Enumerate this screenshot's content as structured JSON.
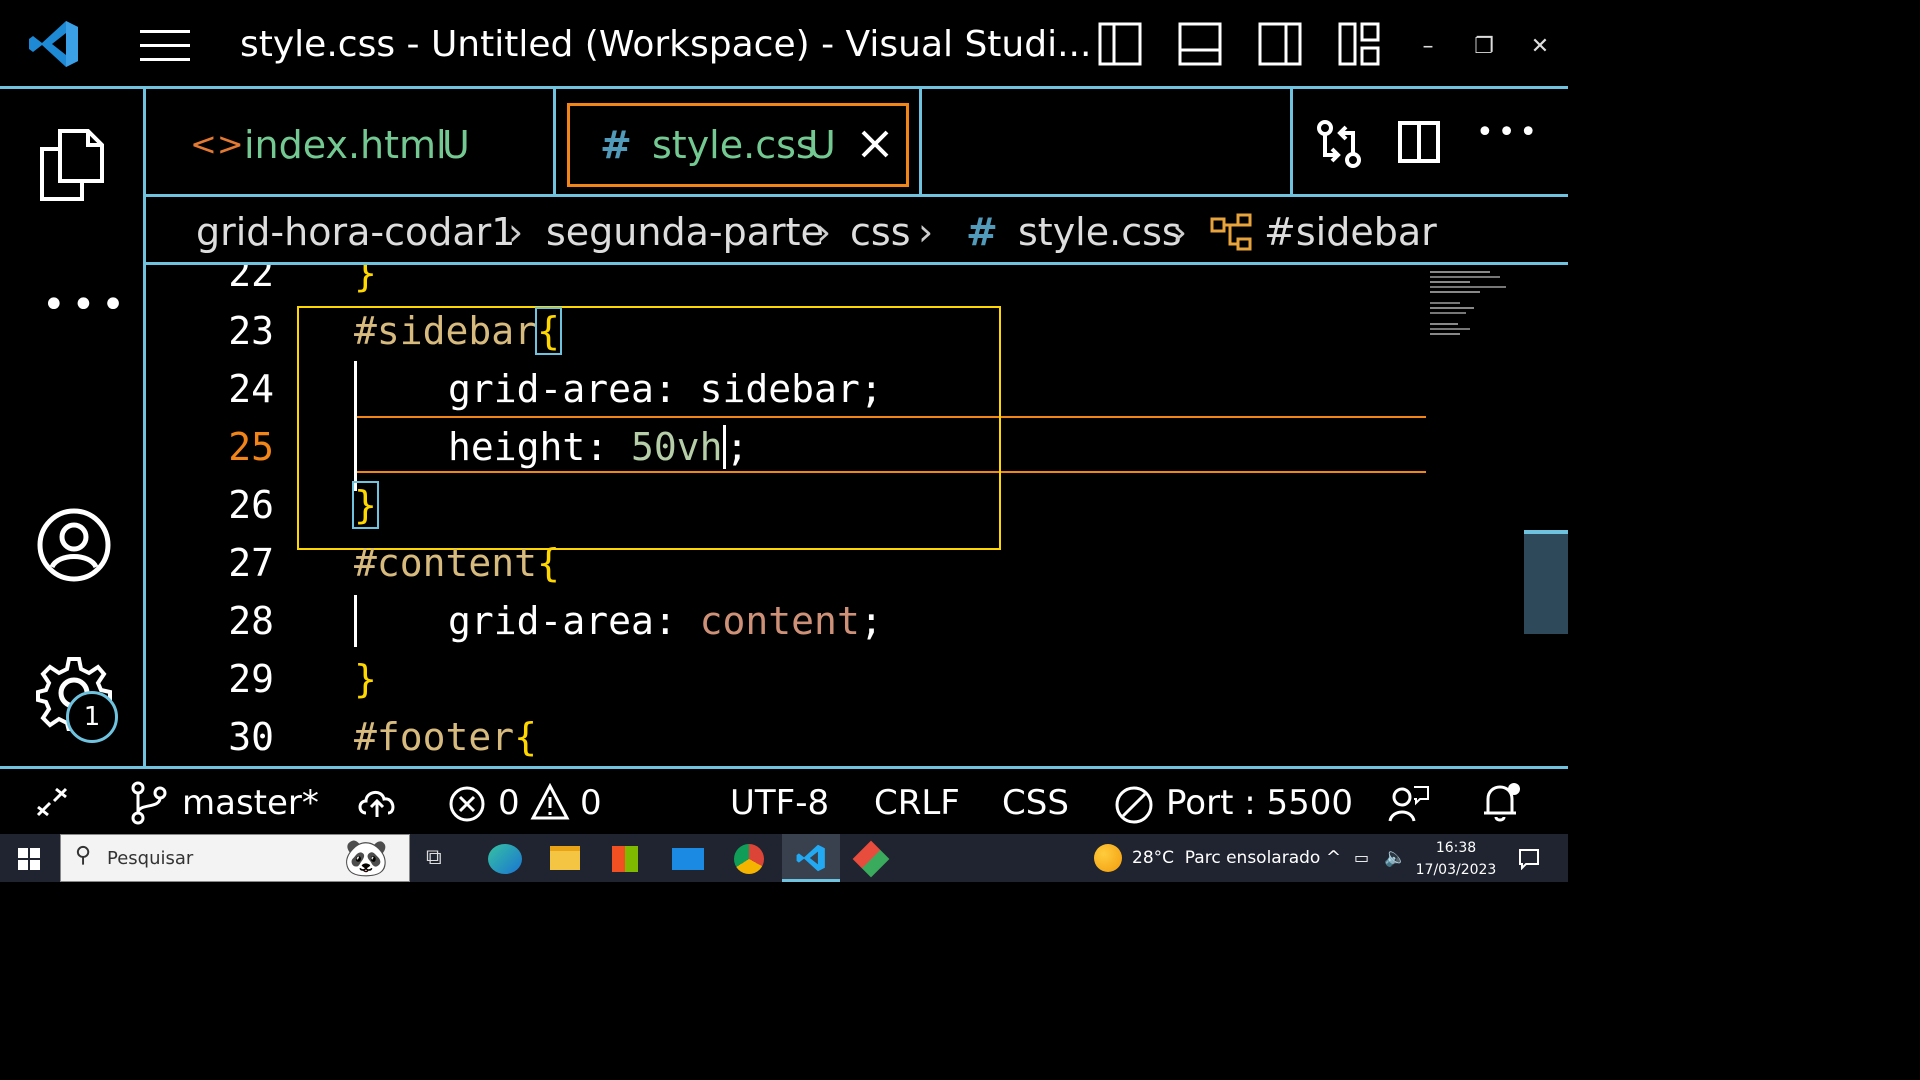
{
  "window": {
    "title": "style.css - Untitled (Workspace) - Visual Studi...",
    "controls": {
      "minimize": "–",
      "restore": "❐",
      "close": "✕"
    }
  },
  "activity_bar": {
    "items": [
      "explorer-icon",
      "more-icon",
      "accounts-icon",
      "manage-icon"
    ],
    "badge": "1"
  },
  "tabs": [
    {
      "label": "index.html",
      "status": "U",
      "icon": "<>"
    },
    {
      "label": "style.css",
      "status": "U",
      "icon": "#"
    }
  ],
  "breadcrumb": {
    "items": [
      "grid-hora-codar1",
      "segunda-parte",
      "css",
      "style.css",
      "#sidebar"
    ],
    "file_icon": "#"
  },
  "editor": {
    "lines": [
      {
        "num": "22",
        "text": "}"
      },
      {
        "num": "23",
        "text": "#sidebar{"
      },
      {
        "num": "24",
        "prop": "grid-area:",
        "value": "sidebar",
        "end": ";"
      },
      {
        "num": "25",
        "prop": "height:",
        "value": "50vh",
        "end": ";"
      },
      {
        "num": "26",
        "text": "}"
      },
      {
        "num": "27",
        "text": "#content{"
      },
      {
        "num": "28",
        "prop": "grid-area:",
        "value": "content",
        "end": ";"
      },
      {
        "num": "29",
        "text": "}"
      },
      {
        "num": "30",
        "text": "#footer{"
      }
    ]
  },
  "status_bar": {
    "branch": "master*",
    "errors": "0",
    "warnings": "0",
    "encoding": "UTF-8",
    "eol": "CRLF",
    "language": "CSS",
    "port": "Port : 5500"
  },
  "taskbar": {
    "search_placeholder": "Pesquisar",
    "weather": "28°C  Parc ensolarado",
    "time": "16:38",
    "date": "17/03/2023"
  },
  "colors": {
    "border": "#6fc3df",
    "active_tab_border": "#f38518",
    "modified": "#73c991",
    "bracket": "#ffd700",
    "selector": "#d7ba7d",
    "value_string": "#ce9178",
    "value_number": "#b5cea8"
  }
}
